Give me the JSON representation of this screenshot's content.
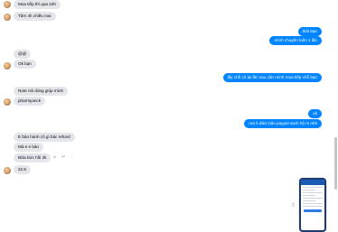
{
  "messages": {
    "m1": "Mua tiếp thì qua 24h",
    "m2": "Tâm 4h chiều mai",
    "m3": "thôi bạn",
    "m4": "mình chuyển luôn 1 lần",
    "m5": "@@",
    "m6": "Ok bạn",
    "m7": "lấy chỗ cũ lại lần sau cần mình mua tiếp chỗ bạn",
    "m8": "Note nói dùng giúp mình",
    "m9": "pharmyanck",
    "m10": "ok",
    "m11": "mà b đảm bảo paypal sạch hộ m nhé",
    "m12": "E bảo hành cô gì bác refund",
    "m13": "Mà e e bảo",
    "m14": "Bữa bức hồi 2k",
    "m15": "22.5"
  },
  "icons": {
    "avatar": "user-avatar",
    "react": "smile-icon",
    "reply": "reply-icon",
    "more": "more-icon",
    "share": "share-icon"
  },
  "colors": {
    "outgoing_bubble": "#0084ff",
    "incoming_bubble": "#e4e6eb",
    "phone_frame": "#1d3b6e"
  }
}
